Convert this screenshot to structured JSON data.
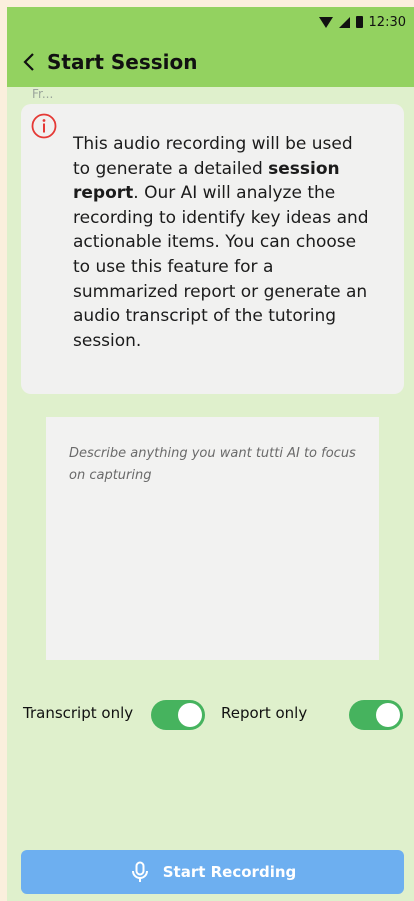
{
  "status_bar": {
    "time": "12:30"
  },
  "header": {
    "title": "Start Session"
  },
  "from_label": "Fr...",
  "info": {
    "text_before": "This audio recording will be used to generate a detailed ",
    "bold": "session report",
    "text_after": ". Our AI will analyze the recording to identify key ideas and actionable items. You can choose to use this feature for a summarized report or generate an audio transcript of the tutoring session."
  },
  "focus": {
    "placeholder": "Describe anything you want tutti AI to focus on capturing",
    "value": ""
  },
  "toggles": [
    {
      "label": "Transcript only",
      "on": true
    },
    {
      "label": "Report only",
      "on": true
    }
  ],
  "colors": {
    "header_bg": "#93d260",
    "page_bg": "#dff0cc",
    "toggle_on": "#46b35e",
    "button_bg": "#6daff0",
    "info_icon": "#e53935"
  },
  "actions": {
    "start_recording_label": "Start Recording"
  }
}
